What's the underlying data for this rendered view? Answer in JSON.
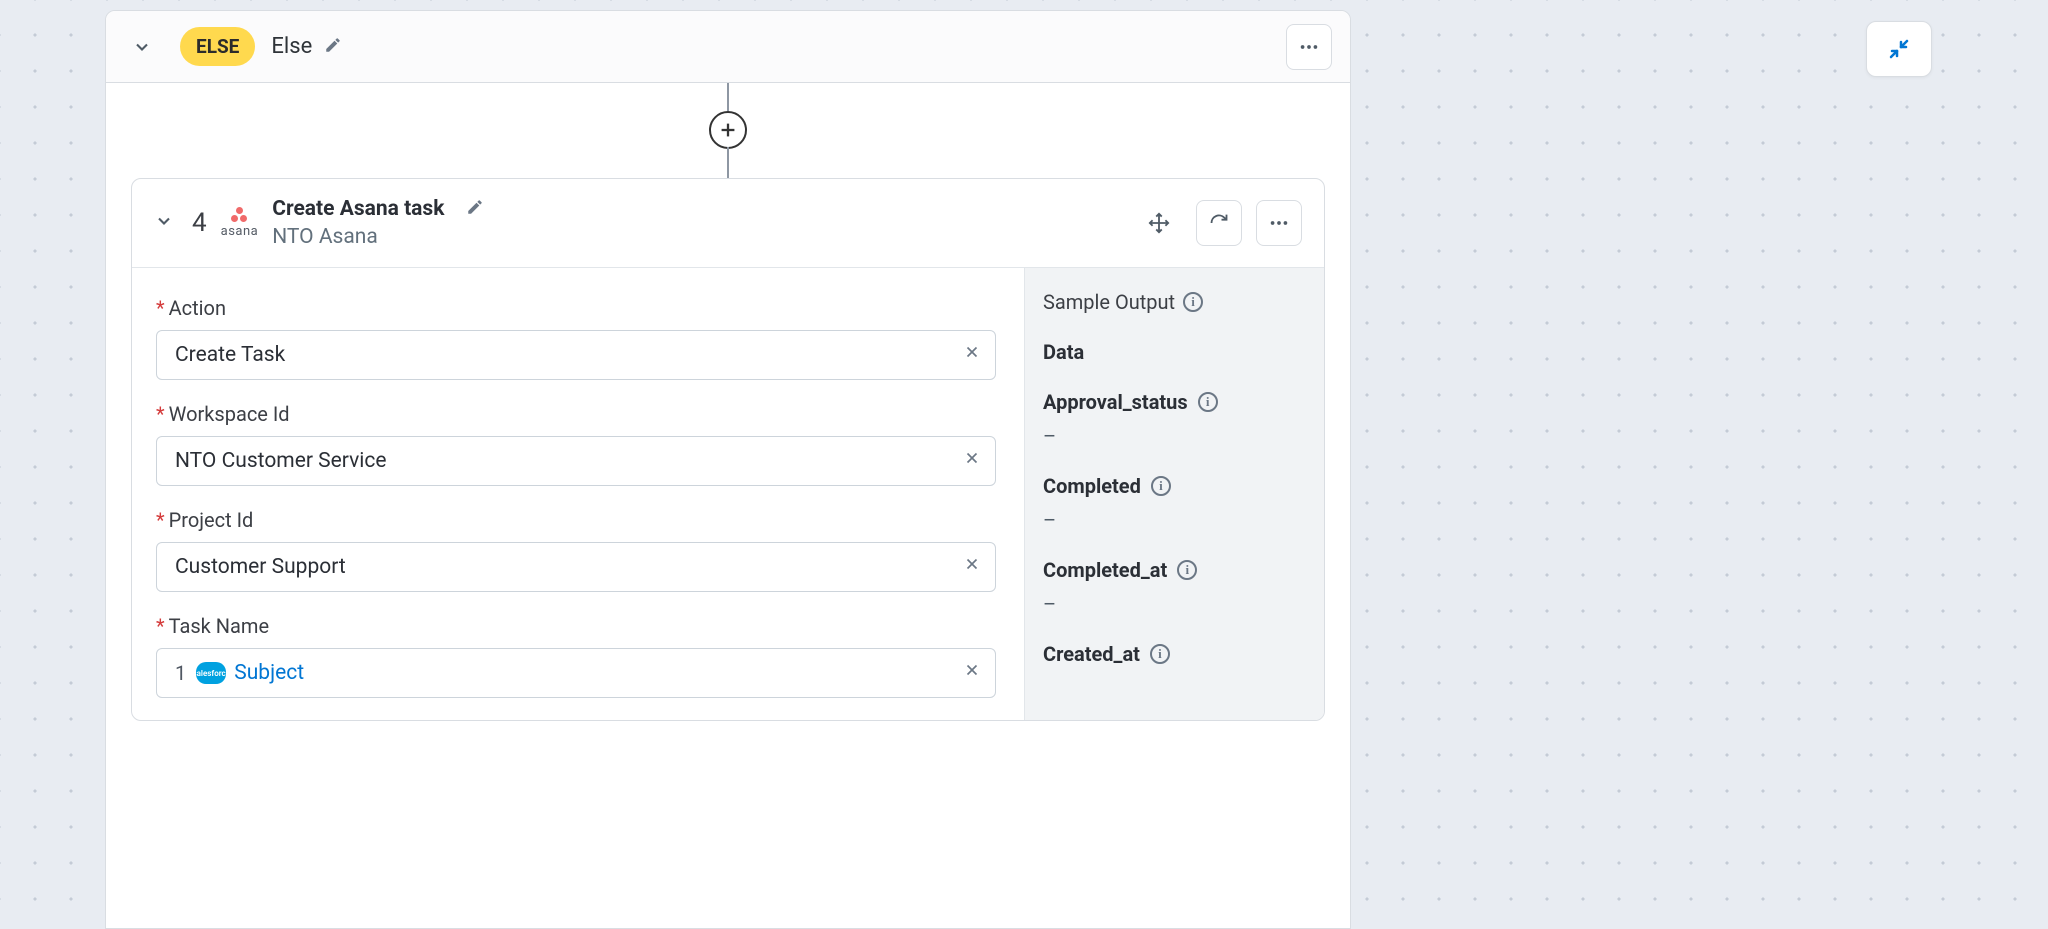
{
  "else_block": {
    "badge": "ELSE",
    "label": "Else"
  },
  "step": {
    "number": "4",
    "logo_text": "asana",
    "title": "Create Asana task",
    "subtitle": "NTO Asana"
  },
  "form": {
    "action": {
      "label": "Action",
      "value": "Create Task"
    },
    "workspace": {
      "label": "Workspace Id",
      "value": "NTO Customer Service"
    },
    "project": {
      "label": "Project Id",
      "value": "Customer Support"
    },
    "taskname": {
      "label": "Task Name",
      "pill_num": "1",
      "pill_badge": "salesforce",
      "pill_text": "Subject"
    }
  },
  "output": {
    "title": "Sample Output",
    "data_label": "Data",
    "items": [
      {
        "key": "Approval_status",
        "val": "–",
        "info": true
      },
      {
        "key": "Completed",
        "val": "–",
        "info": true
      },
      {
        "key": "Completed_at",
        "val": "–",
        "info": true
      },
      {
        "key": "Created_at",
        "val": "",
        "info": true
      }
    ]
  }
}
